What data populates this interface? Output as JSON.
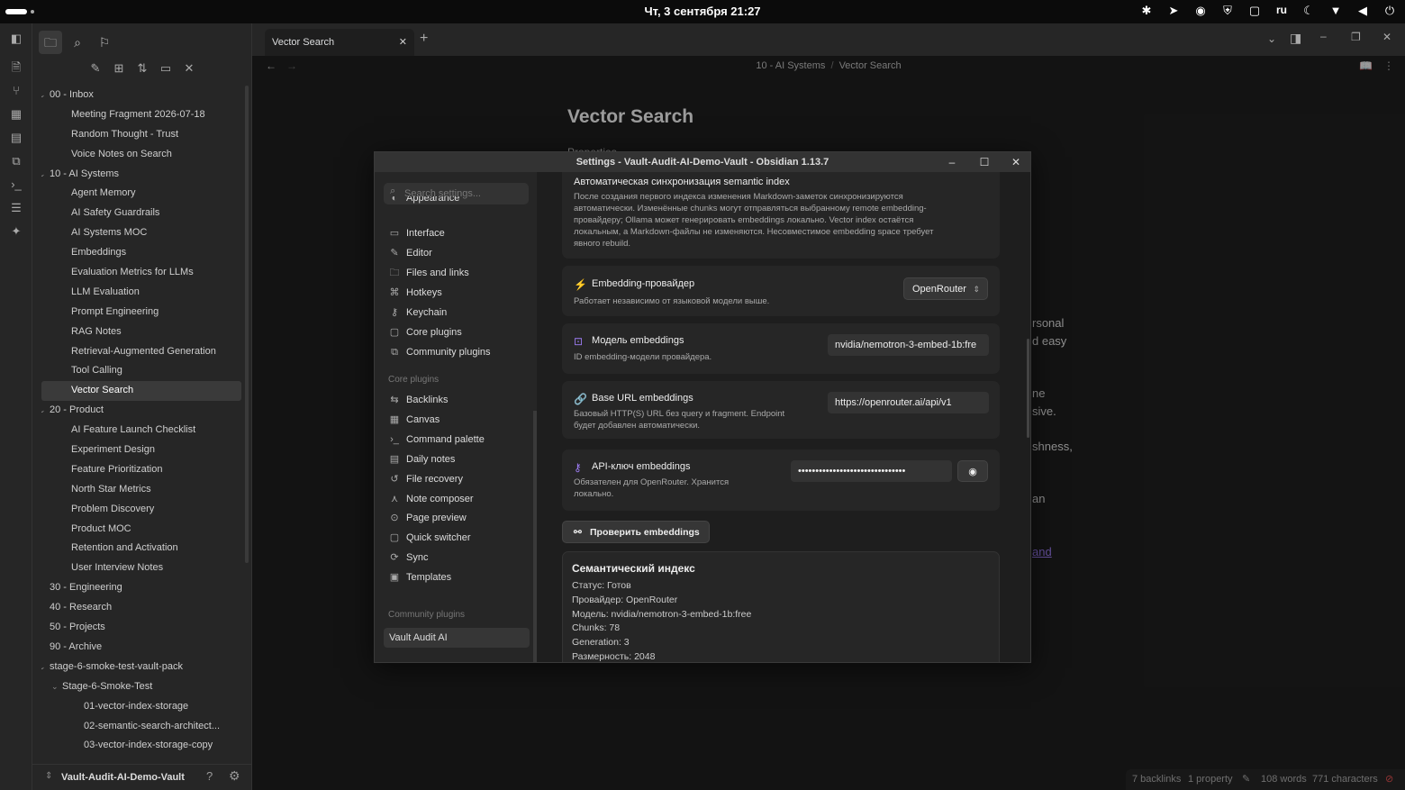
{
  "system_bar": {
    "clock": "Чт, 3 сентября  21:27",
    "lang": "ru",
    "tray_icons": [
      "bluetooth-icon",
      "telegram-icon",
      "steam-icon",
      "shield-icon",
      "clipboard-icon",
      "lang-indicator",
      "moon-icon",
      "wifi-icon",
      "volume-icon",
      "power-icon"
    ]
  },
  "ribbon": {
    "icons": [
      "file-icon",
      "graph-icon",
      "canvas-icon",
      "calendar-icon",
      "copy-icon",
      "terminal-icon",
      "templates-icon",
      "plugin-icon"
    ]
  },
  "sidebar": {
    "tree": [
      {
        "label": "00 - Inbox",
        "level": 0,
        "type": "folder",
        "open": true
      },
      {
        "label": "Meeting Fragment 2026-07-18",
        "level": 1,
        "type": "file"
      },
      {
        "label": "Random Thought - Trust",
        "level": 1,
        "type": "file"
      },
      {
        "label": "Voice Notes on Search",
        "level": 1,
        "type": "file"
      },
      {
        "label": "10 - AI Systems",
        "level": 0,
        "type": "folder",
        "open": true
      },
      {
        "label": "Agent Memory",
        "level": 1,
        "type": "file"
      },
      {
        "label": "AI Safety Guardrails",
        "level": 1,
        "type": "file"
      },
      {
        "label": "AI Systems MOC",
        "level": 1,
        "type": "file"
      },
      {
        "label": "Embeddings",
        "level": 1,
        "type": "file"
      },
      {
        "label": "Evaluation Metrics for LLMs",
        "level": 1,
        "type": "file"
      },
      {
        "label": "LLM Evaluation",
        "level": 1,
        "type": "file"
      },
      {
        "label": "Prompt Engineering",
        "level": 1,
        "type": "file"
      },
      {
        "label": "RAG Notes",
        "level": 1,
        "type": "file"
      },
      {
        "label": "Retrieval-Augmented Generation",
        "level": 1,
        "type": "file"
      },
      {
        "label": "Tool Calling",
        "level": 1,
        "type": "file"
      },
      {
        "label": "Vector Search",
        "level": 1,
        "type": "file",
        "active": true
      },
      {
        "label": "20 - Product",
        "level": 0,
        "type": "folder",
        "open": true
      },
      {
        "label": "AI Feature Launch Checklist",
        "level": 1,
        "type": "file"
      },
      {
        "label": "Experiment Design",
        "level": 1,
        "type": "file"
      },
      {
        "label": "Feature Prioritization",
        "level": 1,
        "type": "file"
      },
      {
        "label": "North Star Metrics",
        "level": 1,
        "type": "file"
      },
      {
        "label": "Problem Discovery",
        "level": 1,
        "type": "file"
      },
      {
        "label": "Product MOC",
        "level": 1,
        "type": "file"
      },
      {
        "label": "Retention and Activation",
        "level": 1,
        "type": "file"
      },
      {
        "label": "User Interview Notes",
        "level": 1,
        "type": "file"
      },
      {
        "label": "30 - Engineering",
        "level": 0,
        "type": "folder",
        "open": false
      },
      {
        "label": "40 - Research",
        "level": 0,
        "type": "folder",
        "open": false
      },
      {
        "label": "50 - Projects",
        "level": 0,
        "type": "folder",
        "open": false
      },
      {
        "label": "90 - Archive",
        "level": 0,
        "type": "folder",
        "open": false
      },
      {
        "label": "stage-6-smoke-test-vault-pack",
        "level": 0,
        "type": "folder",
        "open": true
      },
      {
        "label": "Stage-6-Smoke-Test",
        "level": 1,
        "type": "folder",
        "open": true
      },
      {
        "label": "01-vector-index-storage",
        "level": 2,
        "type": "file"
      },
      {
        "label": "02-semantic-search-architect...",
        "level": 2,
        "type": "file"
      },
      {
        "label": "03-vector-index-storage-copy",
        "level": 2,
        "type": "file"
      }
    ],
    "vault_name": "Vault-Audit-AI-Demo-Vault"
  },
  "tab": {
    "title": "Vector Search"
  },
  "breadcrumb": {
    "folder": "10 - AI Systems",
    "sep": "/",
    "note": "Vector Search"
  },
  "editor": {
    "title": "Vector Search",
    "properties_label": "Properties",
    "fragments": [
      "rsonal",
      "d easy",
      "ne",
      "sive.",
      "shness,",
      "an",
      "and"
    ]
  },
  "status_bar": {
    "backlinks": "7 backlinks",
    "properties": "1 property",
    "words": "108 words",
    "characters": "771 characters"
  },
  "settings": {
    "window_title": "Settings - Vault-Audit-AI-Demo-Vault - Obsidian 1.13.7",
    "search_placeholder": "Search settings...",
    "options_items": [
      "Appearance",
      "Interface",
      "Editor",
      "Files and links",
      "Hotkeys",
      "Keychain",
      "Core plugins",
      "Community plugins"
    ],
    "core_heading": "Core plugins",
    "core_items": [
      "Backlinks",
      "Canvas",
      "Command palette",
      "Daily notes",
      "File recovery",
      "Note composer",
      "Page preview",
      "Quick switcher",
      "Sync",
      "Templates"
    ],
    "community_heading": "Community plugins",
    "community_items": [
      "Vault Audit AI"
    ],
    "auto_sync": {
      "title": "Автоматическая синхронизация semantic index",
      "desc_lines": [
        "После создания первого индекса изменения Markdown-заметок синхронизируются",
        "автоматически. Изменённые chunks могут отправляться выбранному remote embedding-",
        "провайдеру; Ollama может генерировать embeddings локально. Vector index остаётся",
        "локальным, а Markdown-файлы не изменяются. Несовместимое embedding space требует",
        "явного rebuild."
      ]
    },
    "provider": {
      "title": "Embedding-провайдер",
      "desc": "Работает независимо от языковой модели выше.",
      "value": "OpenRouter"
    },
    "model": {
      "title": "Модель embeddings",
      "desc": "ID embedding-модели провайдера.",
      "value": "nvidia/nemotron-3-embed-1b:fre"
    },
    "base_url": {
      "title": "Base URL embeddings",
      "desc_lines": [
        "Базовый HTTP(S) URL без query и fragment. Endpoint",
        "будет добавлен автоматически."
      ],
      "value": "https://openrouter.ai/api/v1"
    },
    "api_key": {
      "title": "API-ключ embeddings",
      "desc_lines": [
        "Обязателен для OpenRouter. Хранится",
        "локально."
      ],
      "value": "•••••••••••••••••••••••••••••••"
    },
    "check_button": "Проверить embeddings",
    "index": {
      "title": "Семантический индекс",
      "lines": [
        "Статус: Готов",
        "Провайдер: OpenRouter",
        "Модель: nvidia/nemotron-3-embed-1b:free",
        "Chunks: 78",
        "Generation: 3",
        "Размерность: 2048"
      ]
    }
  }
}
